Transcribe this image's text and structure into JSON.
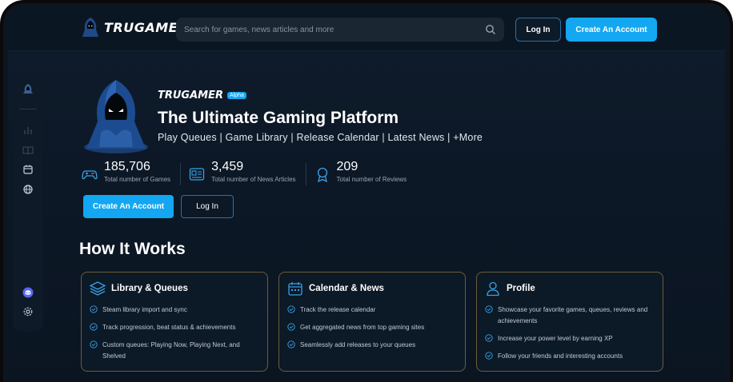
{
  "header": {
    "logo_text": "TRUGAMER",
    "search_placeholder": "Search for games, news articles and more",
    "login_label": "Log In",
    "create_label": "Create An Account"
  },
  "sidebar": {
    "items": [
      "mascot-icon",
      "chart-icon",
      "book-icon",
      "calendar-icon",
      "globe-icon",
      "discord-icon",
      "gear-icon"
    ]
  },
  "hero": {
    "brand": "TRUGAMER",
    "badge": "Alpha",
    "title": "The Ultimate Gaming Platform",
    "subtitle": "Play Queues | Game Library | Release Calendar | Latest News | +More",
    "stats": [
      {
        "value": "185,706",
        "label": "Total number of Games",
        "icon": "gamepad-icon"
      },
      {
        "value": "3,459",
        "label": "Total number of News Articles",
        "icon": "news-icon"
      },
      {
        "value": "209",
        "label": "Total number of Reviews",
        "icon": "award-icon"
      }
    ],
    "create_label": "Create An Account",
    "login_label": "Log In"
  },
  "how": {
    "title": "How It Works",
    "cards": [
      {
        "title": "Library & Queues",
        "icon": "layers-icon",
        "items": [
          "Steam library import and sync",
          "Track progression, beat status & achievements",
          "Custom queues: Playing Now, Playing Next, and Shelved"
        ]
      },
      {
        "title": "Calendar & News",
        "icon": "calendar-icon",
        "items": [
          "Track the release calendar",
          "Get aggregated news from top gaming sites",
          "Seamlessly add releases to your queues"
        ]
      },
      {
        "title": "Profile",
        "icon": "user-icon",
        "items": [
          "Showcase your favorite games, queues, reviews and achievements",
          "Increase your power level by earning XP",
          "Follow your friends and interesting accounts"
        ]
      }
    ]
  },
  "colors": {
    "accent": "#13a7f2",
    "background": "#0c1826",
    "card_border": "#6b5d3a"
  }
}
